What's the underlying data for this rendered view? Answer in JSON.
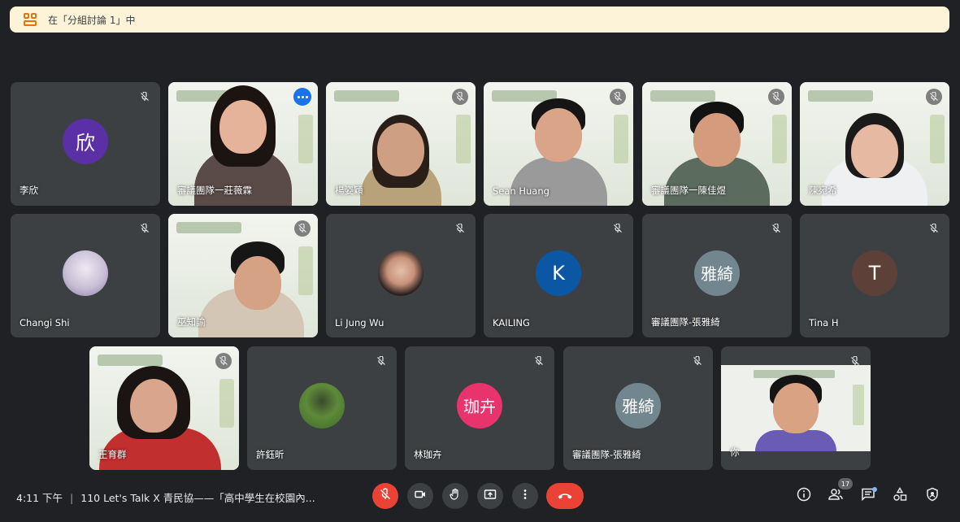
{
  "banner": {
    "text": "在「分組討論 1」中"
  },
  "colors": {
    "accent": "#8ab4f8",
    "mute_red": "#ea4335",
    "banner_bg": "#fdf3d8"
  },
  "tiles": [
    {
      "name": "李欣",
      "avatar": "欣",
      "avatar_color": "#5b2fa6"
    },
    {
      "name": "審議團隊一莊薇霖",
      "video": true,
      "active": true
    },
    {
      "name": "楊姿穎",
      "video": true
    },
    {
      "name": "Sean Huang",
      "video": true
    },
    {
      "name": "審議團隊一陳佳煜",
      "video": true
    },
    {
      "name": "陳宛希",
      "video": true
    },
    {
      "name": "Changi Shi",
      "photo": true
    },
    {
      "name": "巫知諭",
      "video": true
    },
    {
      "name": "Li Jung Wu",
      "photo": true
    },
    {
      "name": "KAILING",
      "avatar": "K",
      "avatar_color": "#0b57a4"
    },
    {
      "name": "審議團隊-張雅綺",
      "avatar": "雅綺",
      "avatar_color": "#72868f"
    },
    {
      "name": "Tina H",
      "avatar": "T",
      "avatar_color": "#5d4037"
    },
    {
      "name": "王育群",
      "video": true
    },
    {
      "name": "許鈺昕",
      "photo": true
    },
    {
      "name": "林珈卉",
      "avatar": "珈卉",
      "avatar_color": "#e8336d"
    },
    {
      "name": "審議團隊-張雅綺",
      "avatar": "雅綺",
      "avatar_color": "#72868f"
    },
    {
      "name": "你",
      "video": true
    }
  ],
  "footer": {
    "time": "4:11 下午",
    "separator": "|",
    "meeting_title": "110 Let's Talk X 青民協——「高中學生在校園內...",
    "participants_count": "17"
  },
  "icons": {
    "banner": "breakout-rooms-icon",
    "tile_mute": "mic-off-icon",
    "controls": [
      "mic-off-icon",
      "camera-icon",
      "raise-hand-icon",
      "present-screen-icon",
      "more-options-icon",
      "end-call-icon"
    ],
    "right": [
      "info-icon",
      "people-icon",
      "chat-icon",
      "activities-icon",
      "host-controls-icon"
    ]
  }
}
